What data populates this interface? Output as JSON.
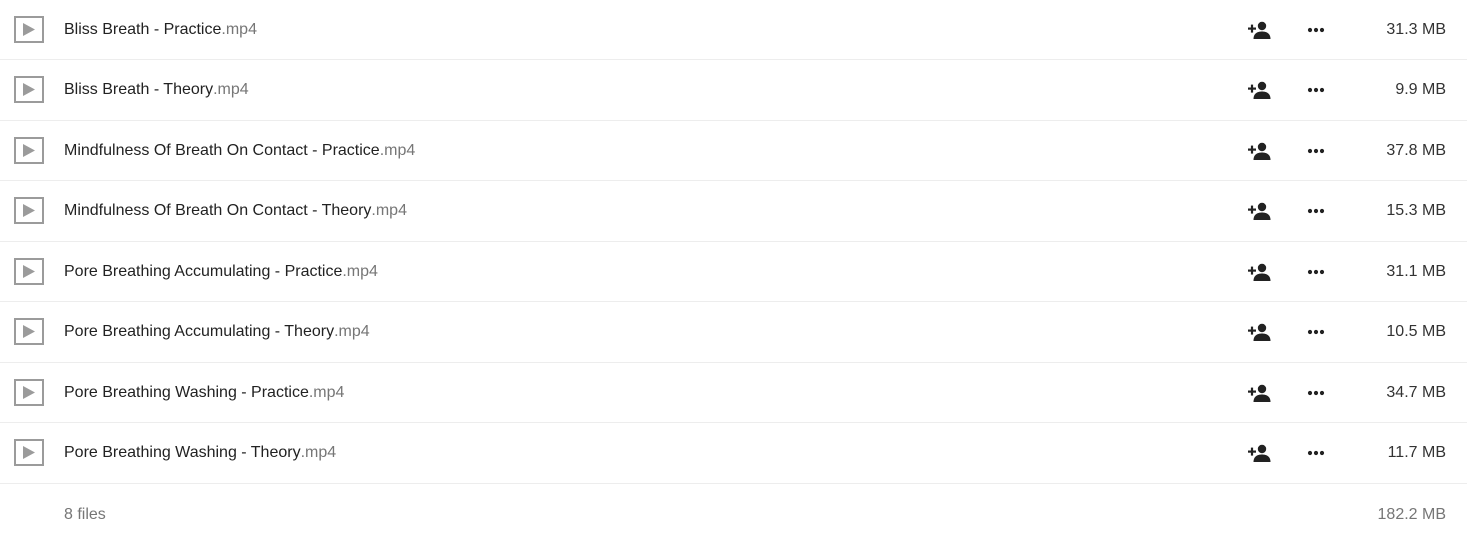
{
  "files": [
    {
      "basename": "Bliss Breath - Practice",
      "extension": ".mp4",
      "size": "31.3 MB",
      "icon": "video-play-icon"
    },
    {
      "basename": "Bliss Breath - Theory",
      "extension": ".mp4",
      "size": "9.9 MB",
      "icon": "video-play-icon"
    },
    {
      "basename": "Mindfulness Of Breath On Contact - Practice",
      "extension": ".mp4",
      "size": "37.8 MB",
      "icon": "video-play-icon"
    },
    {
      "basename": "Mindfulness Of Breath On Contact - Theory",
      "extension": ".mp4",
      "size": "15.3 MB",
      "icon": "video-play-icon"
    },
    {
      "basename": "Pore Breathing Accumulating - Practice",
      "extension": ".mp4",
      "size": "31.1 MB",
      "icon": "video-play-icon"
    },
    {
      "basename": "Pore Breathing Accumulating - Theory",
      "extension": ".mp4",
      "size": "10.5 MB",
      "icon": "video-play-icon"
    },
    {
      "basename": "Pore Breathing Washing - Practice",
      "extension": ".mp4",
      "size": "34.7 MB",
      "icon": "video-play-icon"
    },
    {
      "basename": "Pore Breathing Washing - Theory",
      "extension": ".mp4",
      "size": "11.7 MB",
      "icon": "video-play-icon"
    }
  ],
  "row_actions": {
    "share_icon": "share-person-add-icon",
    "menu_icon": "more-horizontal-icon"
  },
  "summary": {
    "count_label": "8 files",
    "total_size": "182.2 MB"
  },
  "colors": {
    "text": "#222222",
    "extension": "#767676",
    "divider": "#ededed",
    "thumbnail_border": "#9b9b9b",
    "icon": "#222222"
  }
}
